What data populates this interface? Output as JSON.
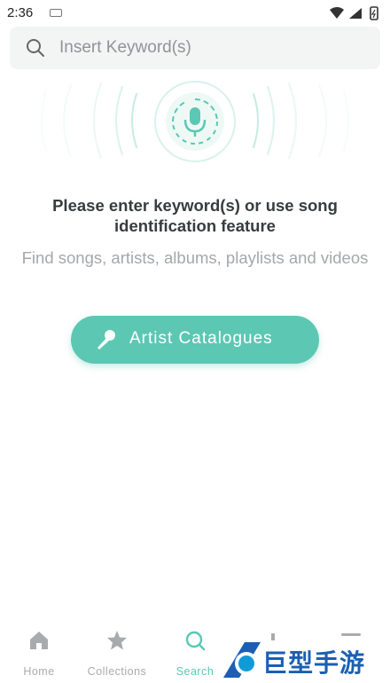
{
  "status_bar": {
    "time": "2:36"
  },
  "search": {
    "placeholder": "Insert Keyword(s)"
  },
  "main": {
    "prompt_title": "Please enter keyword(s) or use song identification feature",
    "prompt_subtitle": "Find songs, artists, albums, playlists and videos",
    "artist_button_label": "Artist Catalogues"
  },
  "bottom_nav": {
    "items": [
      {
        "label": "Home",
        "icon": "home-icon",
        "active": false
      },
      {
        "label": "Collections",
        "icon": "star-icon",
        "active": false
      },
      {
        "label": "Search",
        "icon": "search-icon",
        "active": true
      }
    ]
  },
  "watermark": {
    "text": "巨型手游网"
  },
  "colors": {
    "accent": "#5cc7b3",
    "inactive": "#a8abad",
    "search_bg": "#f3f4f4"
  }
}
